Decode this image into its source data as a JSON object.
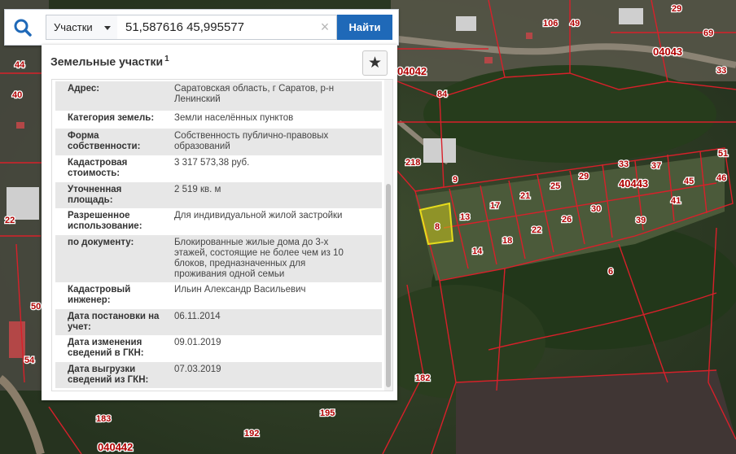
{
  "search": {
    "mode_label": "Участки",
    "query_value": "51,587616 45,995577",
    "clear_symbol": "×",
    "find_label": "Найти",
    "search_icon": "search-icon"
  },
  "panel": {
    "title": "Земельные участки",
    "title_sup": "1",
    "star_icon": "star-icon",
    "rows": [
      {
        "key": "Адрес:",
        "value": "Саратовская область, г Саратов, р-н Ленинский"
      },
      {
        "key": "Категория земель:",
        "value": "Земли населённых пунктов"
      },
      {
        "key": "Форма собственности:",
        "value": "Собственность публично-правовых образований"
      },
      {
        "key": "Кадастровая стоимость:",
        "value": "3 317 573,38 руб."
      },
      {
        "key": "Уточненная площадь:",
        "value": "2 519 кв. м"
      },
      {
        "key": "Разрешенное использование:",
        "value": "Для индивидуальной жилой застройки"
      },
      {
        "key": "по документу:",
        "value": "Блокированные жилые дома до 3-х этажей, состоящие не более чем из 10 блоков, предназначенных для проживания одной семьи"
      },
      {
        "key": "Кадастровый инженер:",
        "value": "Ильин Александр Васильевич"
      },
      {
        "key": "Дата постановки на учет:",
        "value": "06.11.2014"
      },
      {
        "key": "Дата изменения сведений в ГКН:",
        "value": "09.01.2019"
      },
      {
        "key": "Дата выгрузки сведений из ГКН:",
        "value": "07.03.2019"
      }
    ]
  },
  "map": {
    "parcel_labels": [
      "106",
      "49",
      "69",
      "29",
      "33",
      "04043",
      "04042",
      "84",
      "40",
      "44",
      "218",
      "9",
      "51",
      "40443",
      "39",
      "6",
      "8",
      "13",
      "17",
      "21",
      "25",
      "29",
      "33",
      "37",
      "41",
      "45",
      "46",
      "14",
      "18",
      "22",
      "26",
      "30",
      "31",
      "182",
      "195",
      "192",
      "183",
      "040442",
      "50",
      "54",
      "22"
    ],
    "colors": {
      "boundary": "#d8202a",
      "highlight": "#e6dc1c",
      "accent": "#1f69b8"
    }
  }
}
